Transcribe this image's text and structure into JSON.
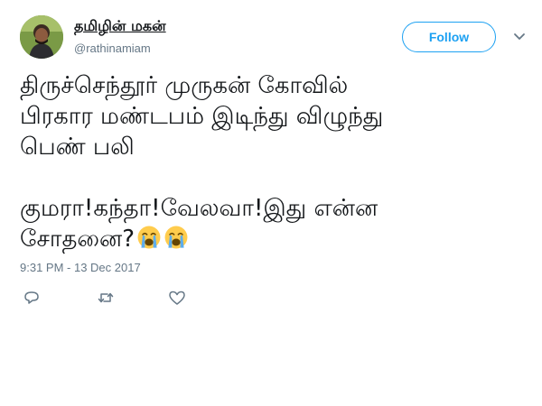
{
  "user": {
    "name": "தமிழின் மகன்",
    "handle": "@rathinamiam"
  },
  "header": {
    "follow_label": "Follow"
  },
  "tweet": {
    "lines": [
      "திருச்செந்தூர் முருகன் கோவில்",
      "பிரகார மண்டபம் இடிந்து விழுந்து",
      "பெண் பலி"
    ],
    "line4": "குமரா!கந்தா!வேலவா!இது என்ன",
    "line5": "சோதனை?",
    "emoji": [
      "crying-face-emoji",
      "crying-face-emoji"
    ]
  },
  "timestamp": "9:31 PM - 13 Dec 2017",
  "actions": {
    "icons": [
      "reply-icon",
      "retweet-icon",
      "like-icon"
    ],
    "color": "#657786"
  },
  "colors": {
    "accent": "#1da1f2",
    "secondary_text": "#657786",
    "emoji_face": "#ffcc4d",
    "emoji_tears": "#5dadec"
  }
}
